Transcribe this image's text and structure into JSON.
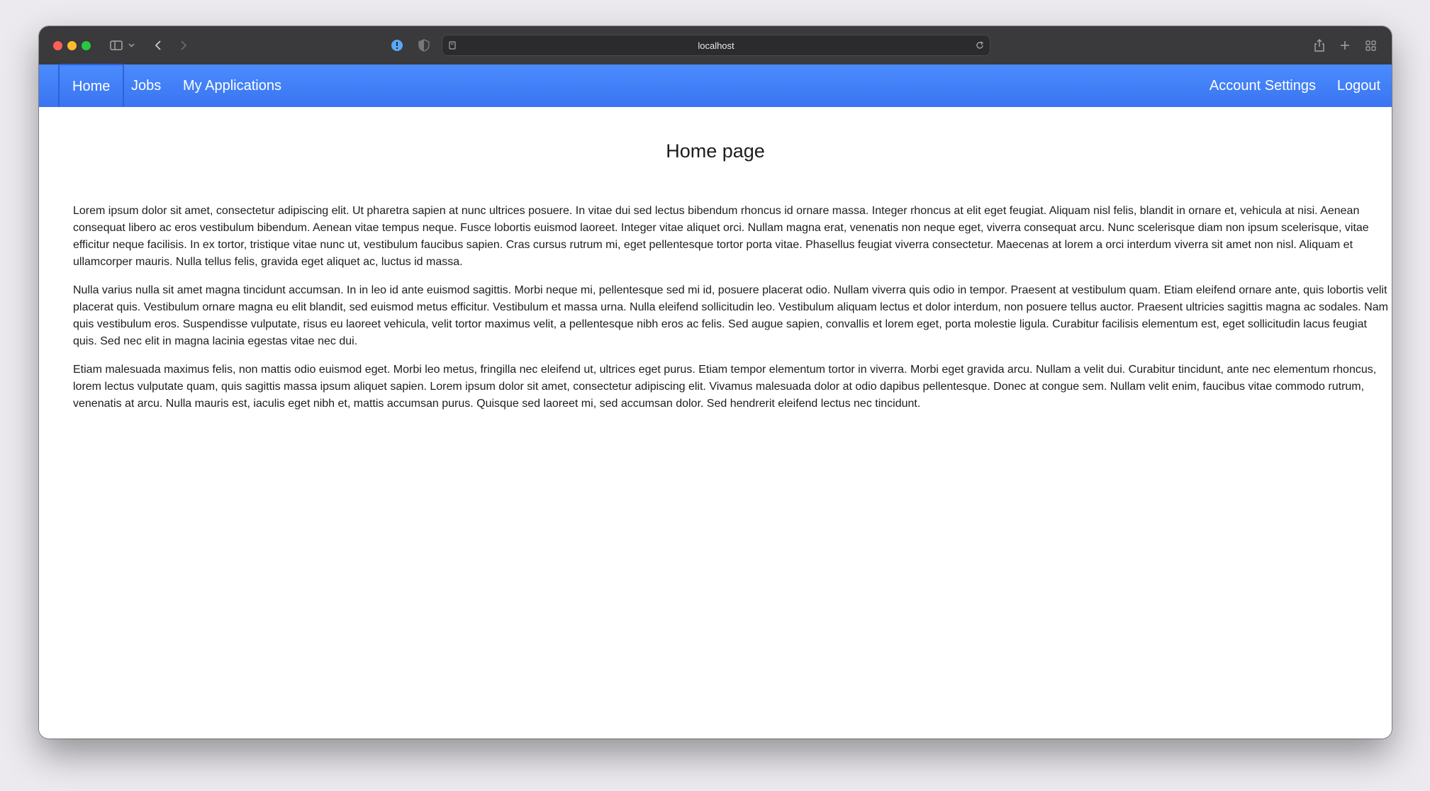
{
  "browser": {
    "url": "localhost",
    "icons": {
      "sidebar": "sidebar-icon",
      "chevron": "chevron-down-icon",
      "back": "back-arrow-icon",
      "forward": "forward-arrow-icon",
      "password": "password-alert-icon",
      "privacy": "privacy-shield-icon",
      "page": "page-icon",
      "reload": "reload-icon",
      "share": "share-icon",
      "new_tab": "plus-icon",
      "tabs": "tab-overview-icon"
    },
    "colors": {
      "close": "#fe5f57",
      "minimize": "#febc2e",
      "maximize": "#28c840"
    }
  },
  "nav": {
    "left": [
      "Home",
      "Jobs",
      "My Applications"
    ],
    "right": [
      "Account Settings",
      "Logout"
    ],
    "colors": {
      "background": "#3f7ff6",
      "active_border": "#2d62d8"
    }
  },
  "main": {
    "title": "Home page",
    "paragraphs": [
      "Lorem ipsum dolor sit amet, consectetur adipiscing elit. Ut pharetra sapien at nunc ultrices posuere. In vitae dui sed lectus bibendum rhoncus id ornare massa. Integer rhoncus at elit eget feugiat. Aliquam nisl felis, blandit in ornare et, vehicula at nisi. Aenean consequat libero ac eros vestibulum bibendum. Aenean vitae tempus neque. Fusce lobortis euismod laoreet. Integer vitae aliquet orci. Nullam magna erat, venenatis non neque eget, viverra consequat arcu. Nunc scelerisque diam non ipsum scelerisque, vitae efficitur neque facilisis. In ex tortor, tristique vitae nunc ut, vestibulum faucibus sapien. Cras cursus rutrum mi, eget pellentesque tortor porta vitae. Phasellus feugiat viverra consectetur. Maecenas at lorem a orci interdum viverra sit amet non nisl. Aliquam et ullamcorper mauris. Nulla tellus felis, gravida eget aliquet ac, luctus id massa.",
      "Nulla varius nulla sit amet magna tincidunt accumsan. In in leo id ante euismod sagittis. Morbi neque mi, pellentesque sed mi id, posuere placerat odio. Nullam viverra quis odio in tempor. Praesent at vestibulum quam. Etiam eleifend ornare ante, quis lobortis velit placerat quis. Vestibulum ornare magna eu elit blandit, sed euismod metus efficitur. Vestibulum et massa urna. Nulla eleifend sollicitudin leo. Vestibulum aliquam lectus et dolor interdum, non posuere tellus auctor. Praesent ultricies sagittis magna ac sodales. Nam quis vestibulum eros. Suspendisse vulputate, risus eu laoreet vehicula, velit tortor maximus velit, a pellentesque nibh eros ac felis. Sed augue sapien, convallis et lorem eget, porta molestie ligula. Curabitur facilisis elementum est, eget sollicitudin lacus feugiat quis. Sed nec elit in magna lacinia egestas vitae nec dui.",
      "Etiam malesuada maximus felis, non mattis odio euismod eget. Morbi leo metus, fringilla nec eleifend ut, ultrices eget purus. Etiam tempor elementum tortor in viverra. Morbi eget gravida arcu. Nullam a velit dui. Curabitur tincidunt, ante nec elementum rhoncus, lorem lectus vulputate quam, quis sagittis massa ipsum aliquet sapien. Lorem ipsum dolor sit amet, consectetur adipiscing elit. Vivamus malesuada dolor at odio dapibus pellentesque. Donec at congue sem. Nullam velit enim, faucibus vitae commodo rutrum, venenatis at arcu. Nulla mauris est, iaculis eget nibh et, mattis accumsan purus. Quisque sed laoreet mi, sed accumsan dolor. Sed hendrerit eleifend lectus nec tincidunt."
    ]
  }
}
